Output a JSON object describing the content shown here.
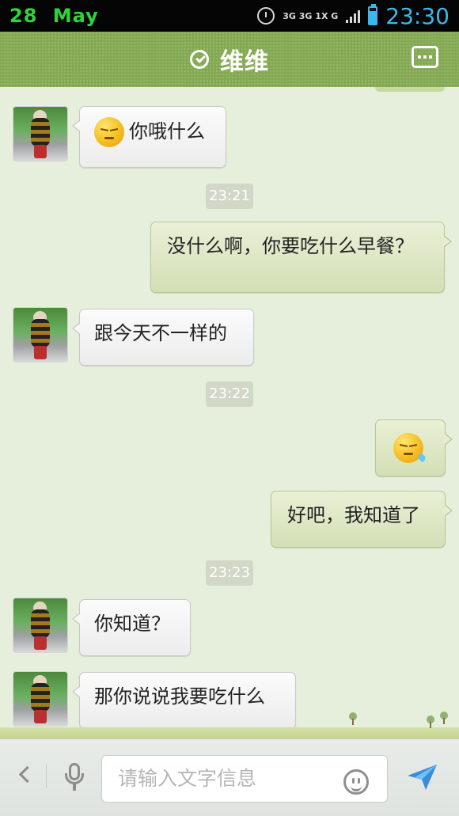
{
  "status_bar": {
    "day": "28",
    "month": "May",
    "network_top": "3G 3G 1X G",
    "time": "23:30"
  },
  "header": {
    "title": "维维"
  },
  "messages": [
    {
      "side": "left",
      "text": "你哦什么",
      "emoji": "smirk-face"
    },
    {
      "type": "time",
      "text": "23:21"
    },
    {
      "side": "right",
      "text": "没什么啊，你要吃什么早餐？"
    },
    {
      "side": "left",
      "text": "跟今天不一样的"
    },
    {
      "type": "time",
      "text": "23:22"
    },
    {
      "side": "right",
      "emoji": "sweat-face"
    },
    {
      "side": "right",
      "text": "好吧，我知道了"
    },
    {
      "type": "time",
      "text": "23:23"
    },
    {
      "side": "left",
      "text": "你知道？"
    },
    {
      "side": "left",
      "text": "那你说说我要吃什么"
    }
  ],
  "composer": {
    "placeholder": "请输入文字信息"
  },
  "colors": {
    "status_bar_bg": "#050505",
    "header_bg": "#84a953",
    "chat_bg": "#e6efdc",
    "outgoing_bubble": "#dbe6c3",
    "incoming_bubble": "#f3f3f3",
    "send_icon": "#3a8ed8"
  },
  "icons": {
    "status": [
      "alarm-clock-icon",
      "signal-icon",
      "battery-icon"
    ],
    "header": [
      "verified-check-icon",
      "more-options-icon"
    ],
    "composer": [
      "back-arrow-icon",
      "microphone-icon",
      "emoji-icon",
      "send-icon"
    ]
  }
}
